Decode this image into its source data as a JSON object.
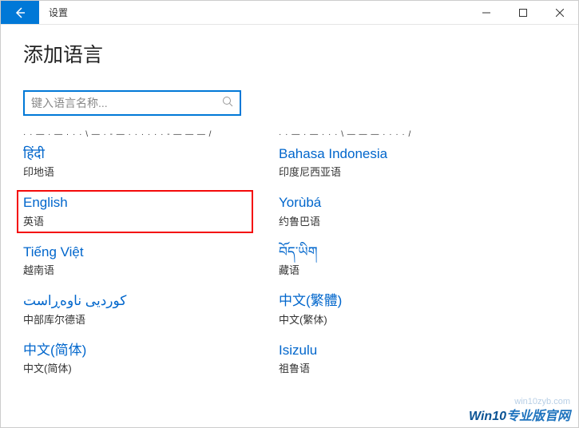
{
  "titlebar": {
    "title": "设置"
  },
  "page_title": "添加语言",
  "search": {
    "placeholder": "键入语言名称..."
  },
  "columns": {
    "left": [
      {
        "native": "हिंदी",
        "local": "印地语",
        "highlighted": false
      },
      {
        "native": "English",
        "local": "英语",
        "highlighted": true
      },
      {
        "native": "Tiếng Việt",
        "local": "越南语",
        "highlighted": false
      },
      {
        "native": "کوردیی ناوەڕاست",
        "local": "中部库尔德语",
        "highlighted": false
      },
      {
        "native": "中文(简体)",
        "local": "中文(简体)",
        "highlighted": false
      }
    ],
    "right": [
      {
        "native": "Bahasa Indonesia",
        "local": "印度尼西亚语",
        "highlighted": false
      },
      {
        "native": "Yorùbá",
        "local": "约鲁巴语",
        "highlighted": false
      },
      {
        "native": "བོད་ཡིག",
        "local": "藏语",
        "highlighted": false
      },
      {
        "native": "中文(繁體)",
        "local": "中文(繁体)",
        "highlighted": false
      },
      {
        "native": "Isizulu",
        "local": "祖鲁语",
        "highlighted": false
      }
    ]
  },
  "watermark": "win10zyb.com",
  "brand": {
    "win": "Win",
    "v10": "10",
    "rest": "专业版官网"
  }
}
